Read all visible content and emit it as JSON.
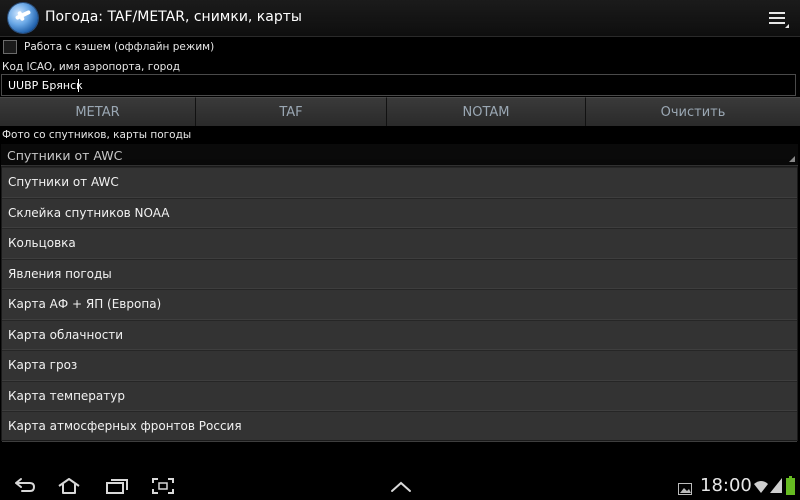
{
  "app": {
    "title": "Погода: TAF/METAR, снимки, карты",
    "icon": "app-globe-plane-icon",
    "overflow_icon": "overflow-menu-icon"
  },
  "cache": {
    "label": "Работа с кэшем (оффлайн режим)",
    "checked": false
  },
  "icao": {
    "label": "Код ICAO, имя аэропорта, город",
    "value": "UUBP Брянск",
    "placeholder": ""
  },
  "buttons": {
    "metar": "METAR",
    "taf": "TAF",
    "notam": "NOTAM",
    "clear": "Очистить"
  },
  "satellite": {
    "label": "Фото со спутников, карты погоды",
    "selected": "Спутники от AWC",
    "options": [
      "Спутники от AWC",
      "Склейка спутников NOAA",
      "Кольцовка",
      "Явления погоды",
      "Карта АФ + ЯП (Европа)",
      "Карта облачности",
      "Карта гроз",
      "Карта температур",
      "Карта атмосферных фронтов Россия"
    ]
  },
  "system_bar": {
    "time": "18:00",
    "nav_icons": [
      "back-icon",
      "home-icon",
      "recent-apps-icon",
      "screenshot-icon",
      "up-chevron-icon"
    ],
    "status_icons": [
      "gallery-notification-icon",
      "wifi-icon",
      "signal-icon",
      "battery-icon"
    ]
  },
  "colors": {
    "background": "#000000",
    "button": "#333333",
    "button_text": "#9aa7b3",
    "list_bg": "#333333",
    "battery": "#66bb22"
  }
}
